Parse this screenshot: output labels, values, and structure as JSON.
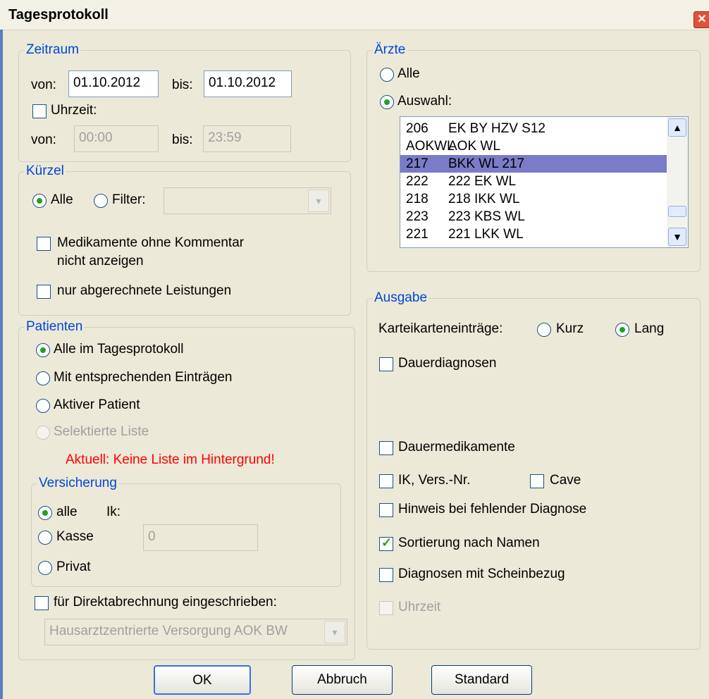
{
  "window": {
    "title": "Tagesprotokoll"
  },
  "zeitraum": {
    "legend": "Zeitraum",
    "von_label": "von:",
    "von_value": "01.10.2012",
    "bis_label": "bis:",
    "bis_value": "01.10.2012",
    "uhrzeit_label": "Uhrzeit:",
    "uhrzeit_checked": false,
    "time_von_label": "von:",
    "time_von_value": "00:00",
    "time_bis_label": "bis:",
    "time_bis_value": "23:59"
  },
  "kuerzel": {
    "legend": "Kürzel",
    "alle_label": "Alle",
    "filter_label": "Filter:",
    "selected": "Alle",
    "filter_value": "",
    "medikamente_label_1": "Medikamente ohne Kommentar",
    "medikamente_label_2": "nicht anzeigen",
    "leistungen_label": "nur abgerechnete Leistungen"
  },
  "patienten": {
    "legend": "Patienten",
    "options": [
      "Alle im Tagesprotokoll",
      "Mit entsprechenden Einträgen",
      "Aktiver Patient",
      "Selektierte Liste"
    ],
    "selected": "Alle im Tagesprotokoll",
    "warning": "Aktuell: Keine Liste im Hintergrund!",
    "versicherung": {
      "legend": "Versicherung",
      "alle_label": "alle",
      "ik_label": "Ik:",
      "kasse_label": "Kasse",
      "ik_value": "0",
      "privat_label": "Privat",
      "selected": "alle"
    },
    "direkt_label": "für Direktabrechnung eingeschrieben:",
    "direkt_value": "Hausarztzentrierte Versorgung AOK BW"
  },
  "aerzte": {
    "legend": "Ärzte",
    "alle_label": "Alle",
    "auswahl_label": "Auswahl:",
    "selected": "Auswahl",
    "list": [
      {
        "code": "206",
        "name": "EK BY HZV S12"
      },
      {
        "code": "AOKWL",
        "name": "AOK WL"
      },
      {
        "code": "217",
        "name": "BKK WL 217"
      },
      {
        "code": "222",
        "name": "222 EK WL"
      },
      {
        "code": "218",
        "name": "218 IKK WL"
      },
      {
        "code": "223",
        "name": "223 KBS WL"
      },
      {
        "code": "221",
        "name": "221 LKK WL"
      }
    ],
    "selected_row": "217"
  },
  "ausgabe": {
    "legend": "Ausgabe",
    "kartei_label": "Karteikarteneinträge:",
    "kurz_label": "Kurz",
    "lang_label": "Lang",
    "kartei_selected": "Lang",
    "dauerdiagnosen_label": "Dauerdiagnosen",
    "dauermedikamente_label": "Dauermedikamente",
    "ik_vers_label": "IK, Vers.-Nr.",
    "cave_label": "Cave",
    "hinweis_label": "Hinweis bei fehlender Diagnose",
    "sortierung_label": "Sortierung nach Namen",
    "sortierung_checked": true,
    "scheinbezug_label": "Diagnosen mit Scheinbezug",
    "uhrzeit_label": "Uhrzeit"
  },
  "buttons": {
    "ok": "OK",
    "abbruch": "Abbruch",
    "standard": "Standard"
  },
  "icons": {
    "close": "close-icon",
    "check": "checkmark-icon",
    "scroll_up": "chevron-up-icon",
    "scroll_down": "chevron-down-icon",
    "dropdown": "chevron-down-icon"
  }
}
